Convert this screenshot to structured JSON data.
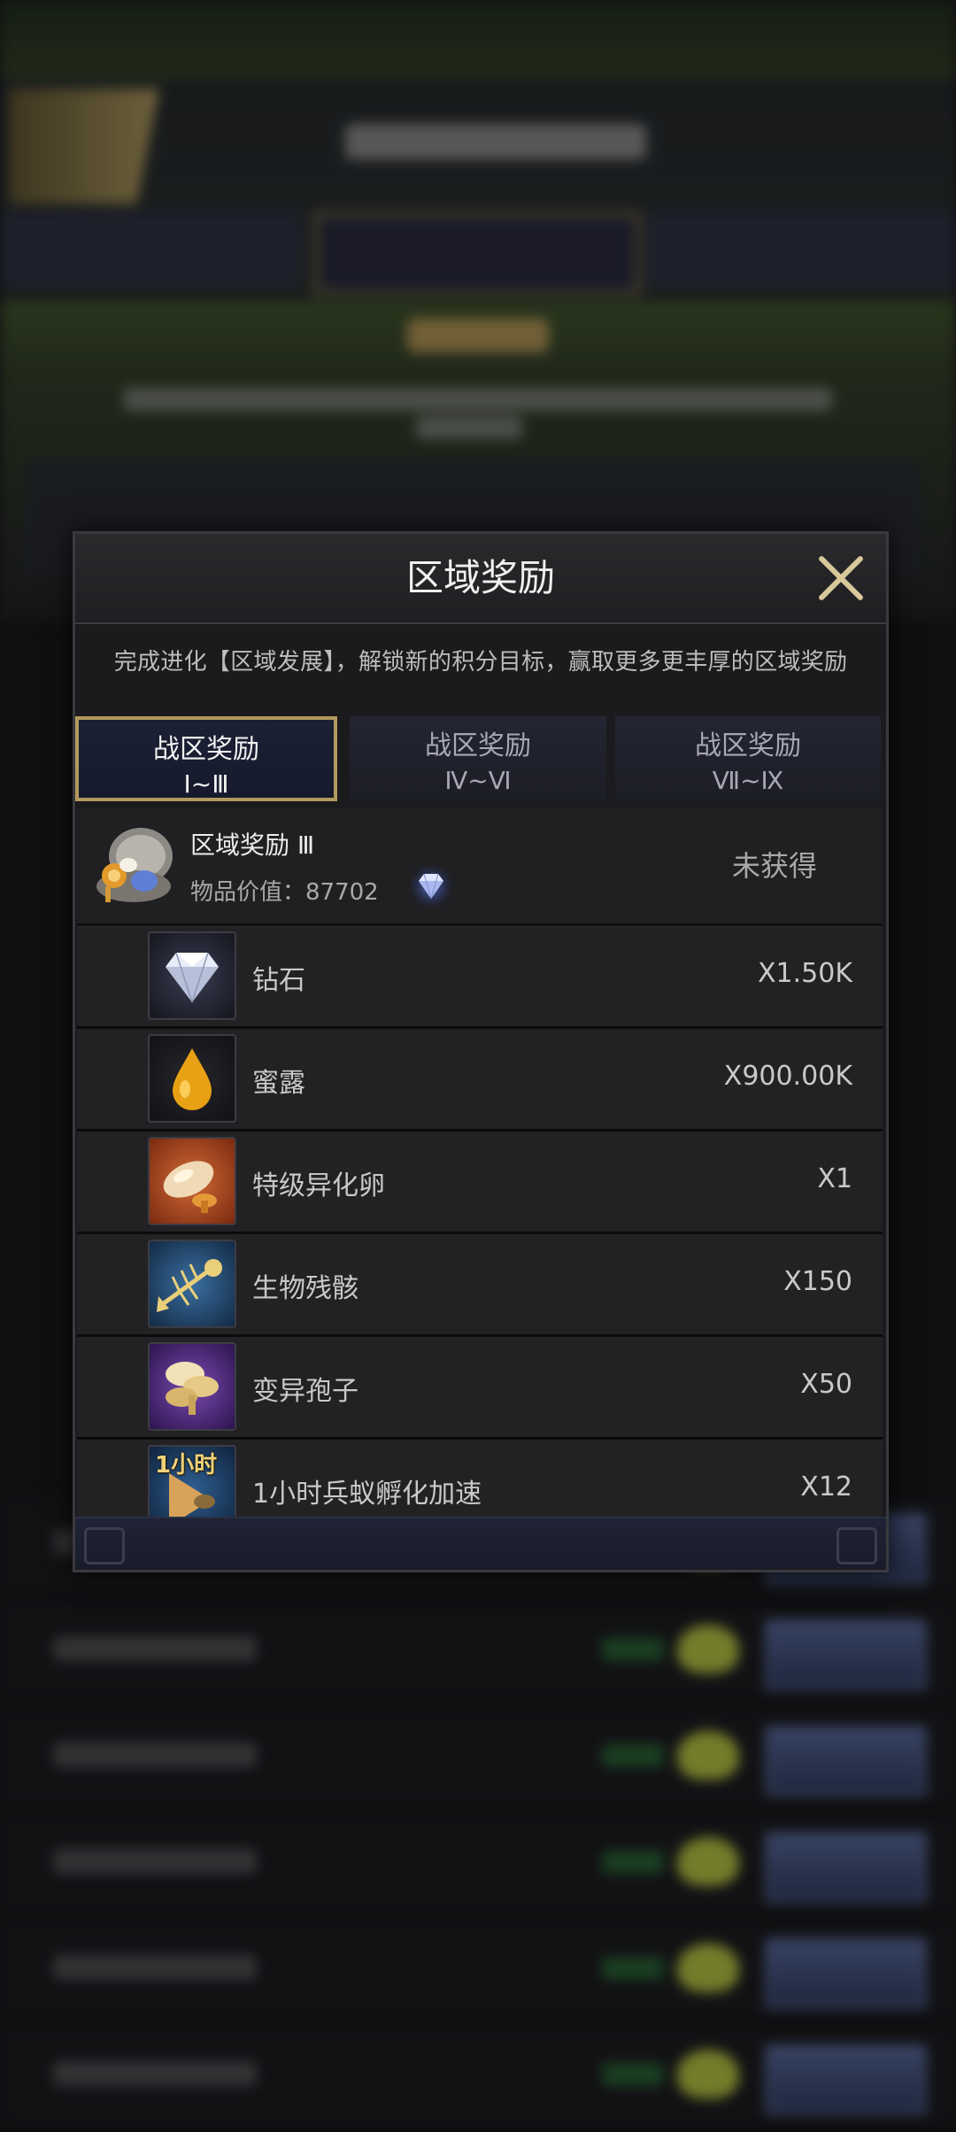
{
  "modal": {
    "title": "区域奖励",
    "description": "完成进化【区域发展】，解锁新的积分目标，赢取更多更丰厚的区域奖励",
    "tabs": [
      {
        "line1": "战区奖励",
        "line2": "Ⅰ~Ⅲ",
        "selected": true
      },
      {
        "line1": "战区奖励",
        "line2": "Ⅳ~Ⅵ",
        "selected": false
      },
      {
        "line1": "战区奖励",
        "line2": "Ⅶ~Ⅸ",
        "selected": false
      }
    ],
    "reward_group": {
      "name": "区域奖励 Ⅲ",
      "value_text": "物品价值：87702",
      "status": "未获得",
      "icon": "chest-icon"
    },
    "items": [
      {
        "name": "钻石",
        "qty": "X1.50K",
        "icon": "diamond-icon"
      },
      {
        "name": "蜜露",
        "qty": "X900.00K",
        "icon": "honeydew-drop-icon"
      },
      {
        "name": "特级异化卵",
        "qty": "X1",
        "icon": "egg-icon"
      },
      {
        "name": "生物残骸",
        "qty": "X150",
        "icon": "fish-skeleton-icon"
      },
      {
        "name": "变异孢子",
        "qty": "X50",
        "icon": "spore-icon"
      },
      {
        "name": "1小时兵蚁孵化加速",
        "qty": "X12",
        "icon": "speedup-icon",
        "icon_label": "1小时"
      }
    ]
  },
  "colors": {
    "accent_gold": "#b29a5d",
    "close_icon": "#d9c89a",
    "modal_bg": "#1b1b1d"
  }
}
